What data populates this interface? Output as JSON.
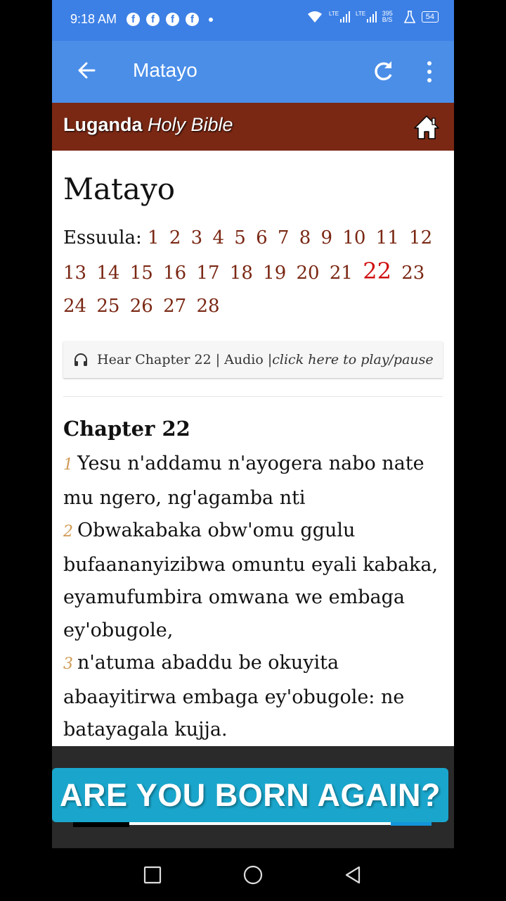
{
  "status": {
    "time": "9:18 AM",
    "notif_icons": [
      "facebook-icon",
      "facebook-icon",
      "facebook-icon",
      "facebook-icon"
    ],
    "network": "LTE",
    "speed": "395 B/S",
    "battery": "54"
  },
  "appbar": {
    "title": "Matayo"
  },
  "banner": {
    "brand_bold": "Luganda",
    "brand_italic": "Holy Bible"
  },
  "book": {
    "title": "Matayo",
    "chapters_label": "Essuula:",
    "chapters": [
      "1",
      "2",
      "3",
      "4",
      "5",
      "6",
      "7",
      "8",
      "9",
      "10",
      "11",
      "12",
      "13",
      "14",
      "15",
      "16",
      "17",
      "18",
      "19",
      "20",
      "21",
      "22",
      "23",
      "24",
      "25",
      "26",
      "27",
      "28"
    ],
    "current_chapter": "22"
  },
  "audio": {
    "text": "Hear Chapter 22 | Audio | ",
    "action": "click here to play/pause"
  },
  "chapter": {
    "heading": "Chapter 22",
    "verses": [
      {
        "num": "1",
        "text": "Yesu n'addamu n'ayogera nabo nate mu ngero, ng'agamba nti"
      },
      {
        "num": "2",
        "text": "Obwakabaka obw'omu ggulu bufaananyizibwa omuntu eyali kabaka, eyamufumbira omwana we embaga ey'obugole,"
      },
      {
        "num": "3",
        "text": "n'atuma abaddu be okuyita abaayitirwa embaga ey'obugole: ne batayagala kujja."
      }
    ]
  },
  "overlay": {
    "cta": "ARE YOU BORN AGAIN?"
  },
  "colors": {
    "statusbar": "#3c80e6",
    "appbar": "#4a8ee8",
    "banner": "#7a2814",
    "chapter_link": "#7a2814",
    "current_chapter": "#d01010",
    "verse_number": "#d09a55",
    "cta": "#1aa6cc"
  }
}
